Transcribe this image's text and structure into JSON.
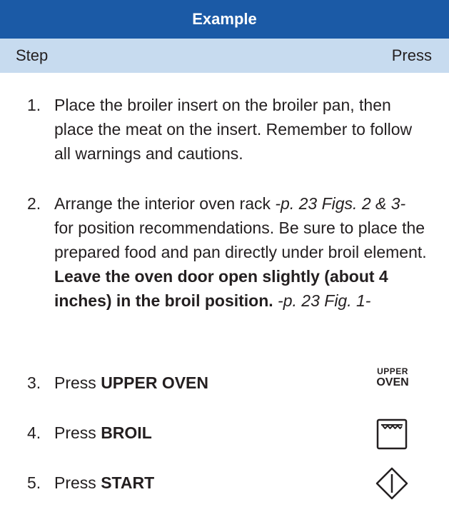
{
  "header": {
    "title": "Example"
  },
  "columns": {
    "step": "Step",
    "press": "Press"
  },
  "steps": [
    {
      "number": "1.",
      "text": "Place the broiler insert on the broiler pan, then place the meat on the insert. Remember to follow all warnings and cautions."
    },
    {
      "number": "2.",
      "text_a": "Arrange the interior oven rack ",
      "ref_a": "-p. 23 Figs. 2 & 3-",
      "text_b": " for position recommendations. Be sure to place the prepared food and pan directly under broil element. ",
      "bold": "Leave the oven door open slightly (about 4 inches) in the broil position.",
      "ref_b": " -p. 23 Fig. 1-"
    },
    {
      "number": "3.",
      "prefix": "Press ",
      "key": "UPPER OVEN",
      "icon": "upper-oven-key-icon",
      "icon_label_top": "UPPER",
      "icon_label_bottom": "OVEN"
    },
    {
      "number": "4.",
      "prefix": "Press ",
      "key": "BROIL",
      "icon": "broil-icon"
    },
    {
      "number": "5.",
      "prefix": "Press ",
      "key": "START",
      "icon": "start-icon"
    }
  ],
  "colors": {
    "header_bg": "#1b5aa6",
    "subheader_bg": "#c7dbef",
    "text": "#231f20"
  }
}
